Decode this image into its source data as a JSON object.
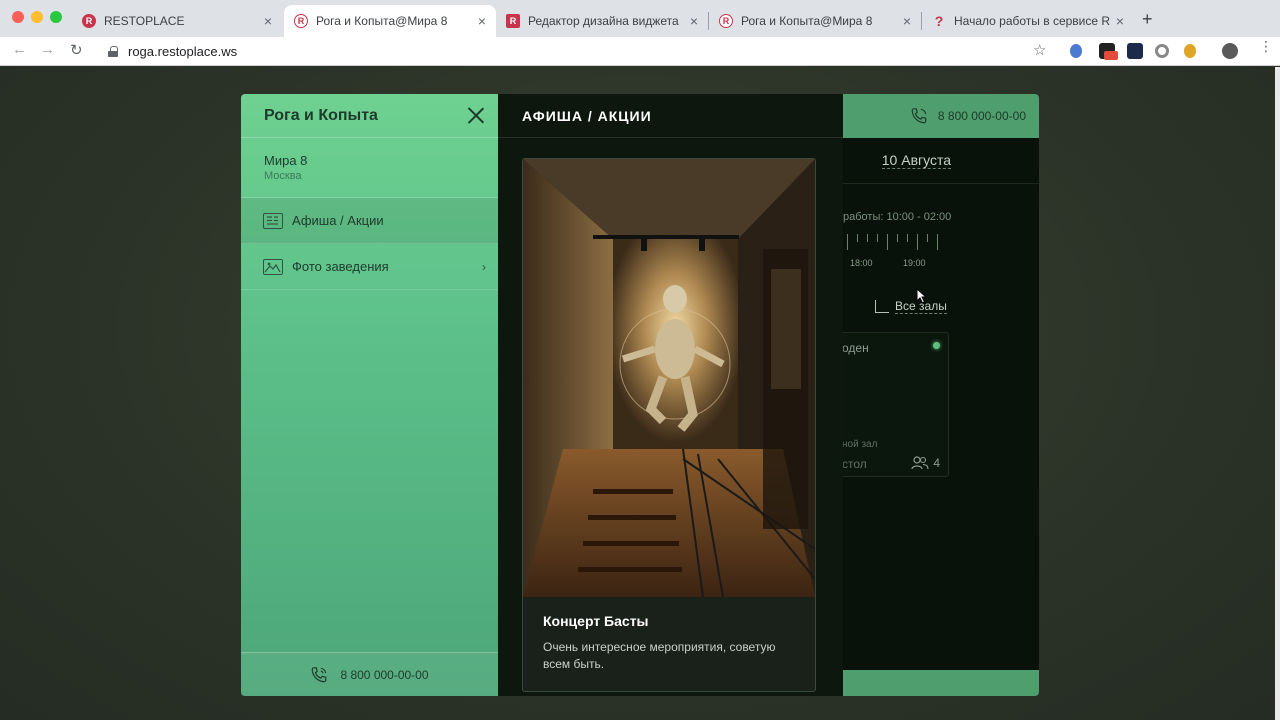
{
  "browser": {
    "tabs": [
      {
        "title": "RESTOPLACE",
        "icon": "restoplace-icon"
      },
      {
        "title": "Рога и Копыта@Мира 8",
        "icon": "restoplace-icon"
      },
      {
        "title": "Редактор дизайна виджета",
        "icon": "restoplace-icon"
      },
      {
        "title": "Рога и Копыта@Мира 8",
        "icon": "restoplace-icon"
      },
      {
        "title": "Начало работы в сервисе Re",
        "icon": "help-icon"
      }
    ],
    "close_glyph": "×",
    "new_tab_glyph": "+",
    "url": "roga.restoplace.ws",
    "back_glyph": "←",
    "forward_glyph": "→",
    "reload_glyph": "↻",
    "star_glyph": "☆"
  },
  "sidebar": {
    "venue_name": "Рога и Копыта",
    "street": "Мира 8",
    "city": "Москва",
    "items": [
      {
        "label": "Афиша / Акции",
        "icon": "newspaper-icon"
      },
      {
        "label": "Фото заведения",
        "icon": "image-icon"
      }
    ],
    "chevron": "›",
    "phone": "8 800 000-00-00"
  },
  "panel": {
    "title": "АФИША / АКЦИИ",
    "card": {
      "title": "Концерт Басты",
      "text": "Очень интересное мероприятия, советую всем быть."
    }
  },
  "booking": {
    "phone": "8 800 000-00-00",
    "date": "10 Августа",
    "hours": "работы: 10:00 - 02:00",
    "time_labels": [
      "18:00",
      "19:00"
    ],
    "all_halls": "Все залы",
    "table": {
      "name": "оден",
      "hall": "ной зал",
      "type": "стол",
      "seats": "4"
    }
  },
  "colors": {
    "accent": "#5cc08a",
    "dark": "#0d170e",
    "brand_red": "#c8344b"
  }
}
